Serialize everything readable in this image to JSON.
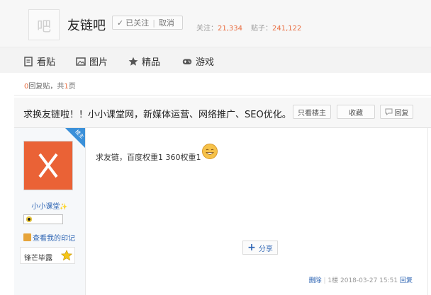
{
  "header": {
    "avatar_glyph": "吧",
    "bar_name": "友链吧",
    "follow": {
      "check": "✓",
      "followed_label": "已关注",
      "separator": "|",
      "cancel_label": "取消"
    },
    "stats": {
      "follow_label": "关注：",
      "follow_count": "21,334",
      "posts_label": "贴子：",
      "posts_count": "241,122"
    }
  },
  "nav": {
    "items": [
      {
        "label": "看贴",
        "icon": "document-icon"
      },
      {
        "label": "图片",
        "icon": "image-icon"
      },
      {
        "label": "精品",
        "icon": "star-icon"
      },
      {
        "label": "游戏",
        "icon": "gamepad-icon"
      }
    ]
  },
  "reply_count": {
    "count": "0",
    "text_mid": "回复贴，共",
    "pages": "1",
    "text_end": "页"
  },
  "thread": {
    "title": "求换友链啦！！小小课堂网，新媒体运营、网络推广、SEO优化。",
    "buttons": {
      "only_op": "只看楼主",
      "favorite": "收藏",
      "reply": "回复"
    }
  },
  "post": {
    "op_badge": "楼主",
    "username": "小小课堂",
    "username_star": "✨",
    "imprint_link": "查看我的印记",
    "medal_label": "锋芒毕露",
    "content": "求友链，百度权重1 360权重1",
    "share_label": "分享",
    "footer": {
      "delete": "删除",
      "floor": "1楼",
      "timestamp": "2018-03-27 15:51",
      "reply": "回复"
    }
  },
  "colors": {
    "accent": "#e96c3f",
    "link": "#2d64b3",
    "avatar_bg": "#ea6236",
    "op_badge": "#3b90d9"
  }
}
